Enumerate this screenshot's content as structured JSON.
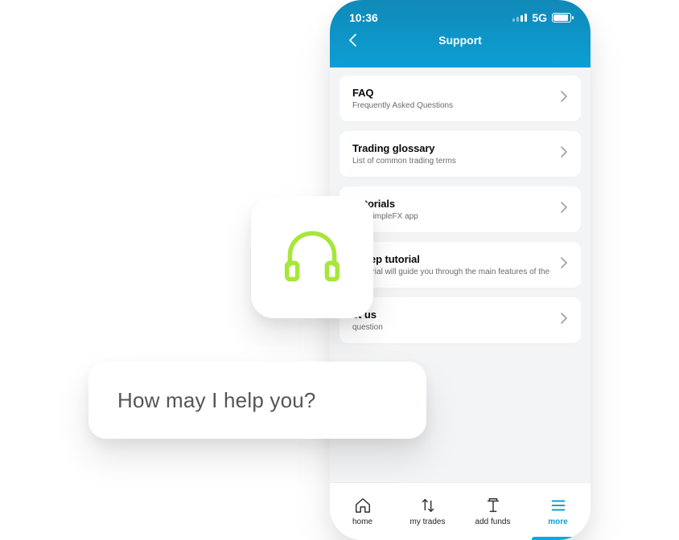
{
  "status": {
    "time": "10:36",
    "network": "5G"
  },
  "nav": {
    "title": "Support"
  },
  "items": [
    {
      "title": "FAQ",
      "sub": "Frequently Asked Questions"
    },
    {
      "title": "Trading glossary",
      "sub": "List of common trading terms"
    },
    {
      "title": "Tutorials",
      "sub": "use SimpleFX app"
    },
    {
      "title": "y step tutorial",
      "sub": "k tutorial will guide you through the main features of the"
    },
    {
      "title": "ct us",
      "sub": "question"
    }
  ],
  "tabs": [
    {
      "label": "home"
    },
    {
      "label": "my trades"
    },
    {
      "label": "add funds"
    },
    {
      "label": "more"
    }
  ],
  "help": {
    "text": "How may I help you?"
  }
}
